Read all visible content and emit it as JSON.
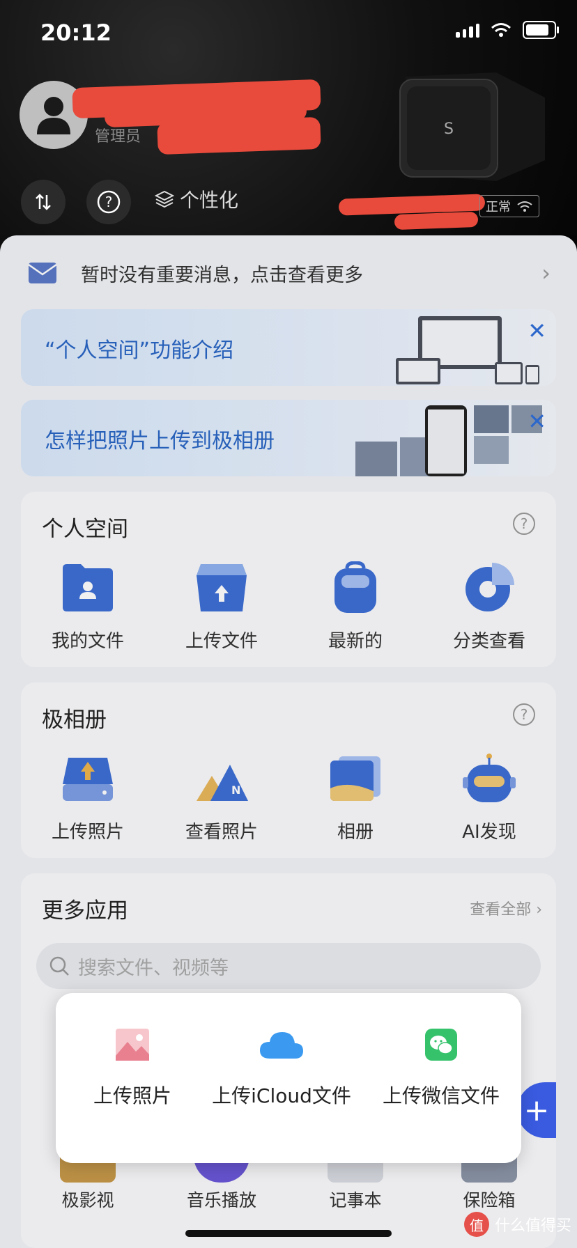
{
  "status_bar": {
    "time": "20:12"
  },
  "header": {
    "role": "管理员",
    "personalize_label": "个性化",
    "device_status": "正常"
  },
  "message": {
    "text": "暂时没有重要消息，点击查看更多"
  },
  "banners": [
    {
      "title": "“个人空间”功能介绍"
    },
    {
      "title": "怎样把照片上传到极相册"
    }
  ],
  "personal_space": {
    "title": "个人空间",
    "items": [
      {
        "label": "我的文件",
        "icon": "folder-user-icon"
      },
      {
        "label": "上传文件",
        "icon": "upload-folder-icon"
      },
      {
        "label": "最新的",
        "icon": "backpack-icon"
      },
      {
        "label": "分类查看",
        "icon": "pie-chart-icon"
      }
    ]
  },
  "album": {
    "title": "极相册",
    "items": [
      {
        "label": "上传照片",
        "icon": "upload-drive-icon"
      },
      {
        "label": "查看照片",
        "icon": "mountain-icon"
      },
      {
        "label": "相册",
        "icon": "photo-stack-icon"
      },
      {
        "label": "AI发现",
        "icon": "robot-icon"
      }
    ]
  },
  "more_apps": {
    "title": "更多应用",
    "see_all": "查看全部",
    "search_placeholder": "搜索文件、视频等",
    "bottom_items": [
      "极影视",
      "音乐播放",
      "记事本",
      "保险箱"
    ]
  },
  "popup": {
    "items": [
      {
        "label": "上传照片",
        "icon": "photo-icon"
      },
      {
        "label": "上传iCloud文件",
        "icon": "icloud-icon"
      },
      {
        "label": "上传微信文件",
        "icon": "wechat-icon"
      }
    ]
  },
  "watermark": {
    "text": "什么值得买",
    "logo": "值"
  },
  "colors": {
    "accent": "#2f6ed8",
    "redaction": "#e84a3c",
    "fab": "#3a5be0"
  }
}
